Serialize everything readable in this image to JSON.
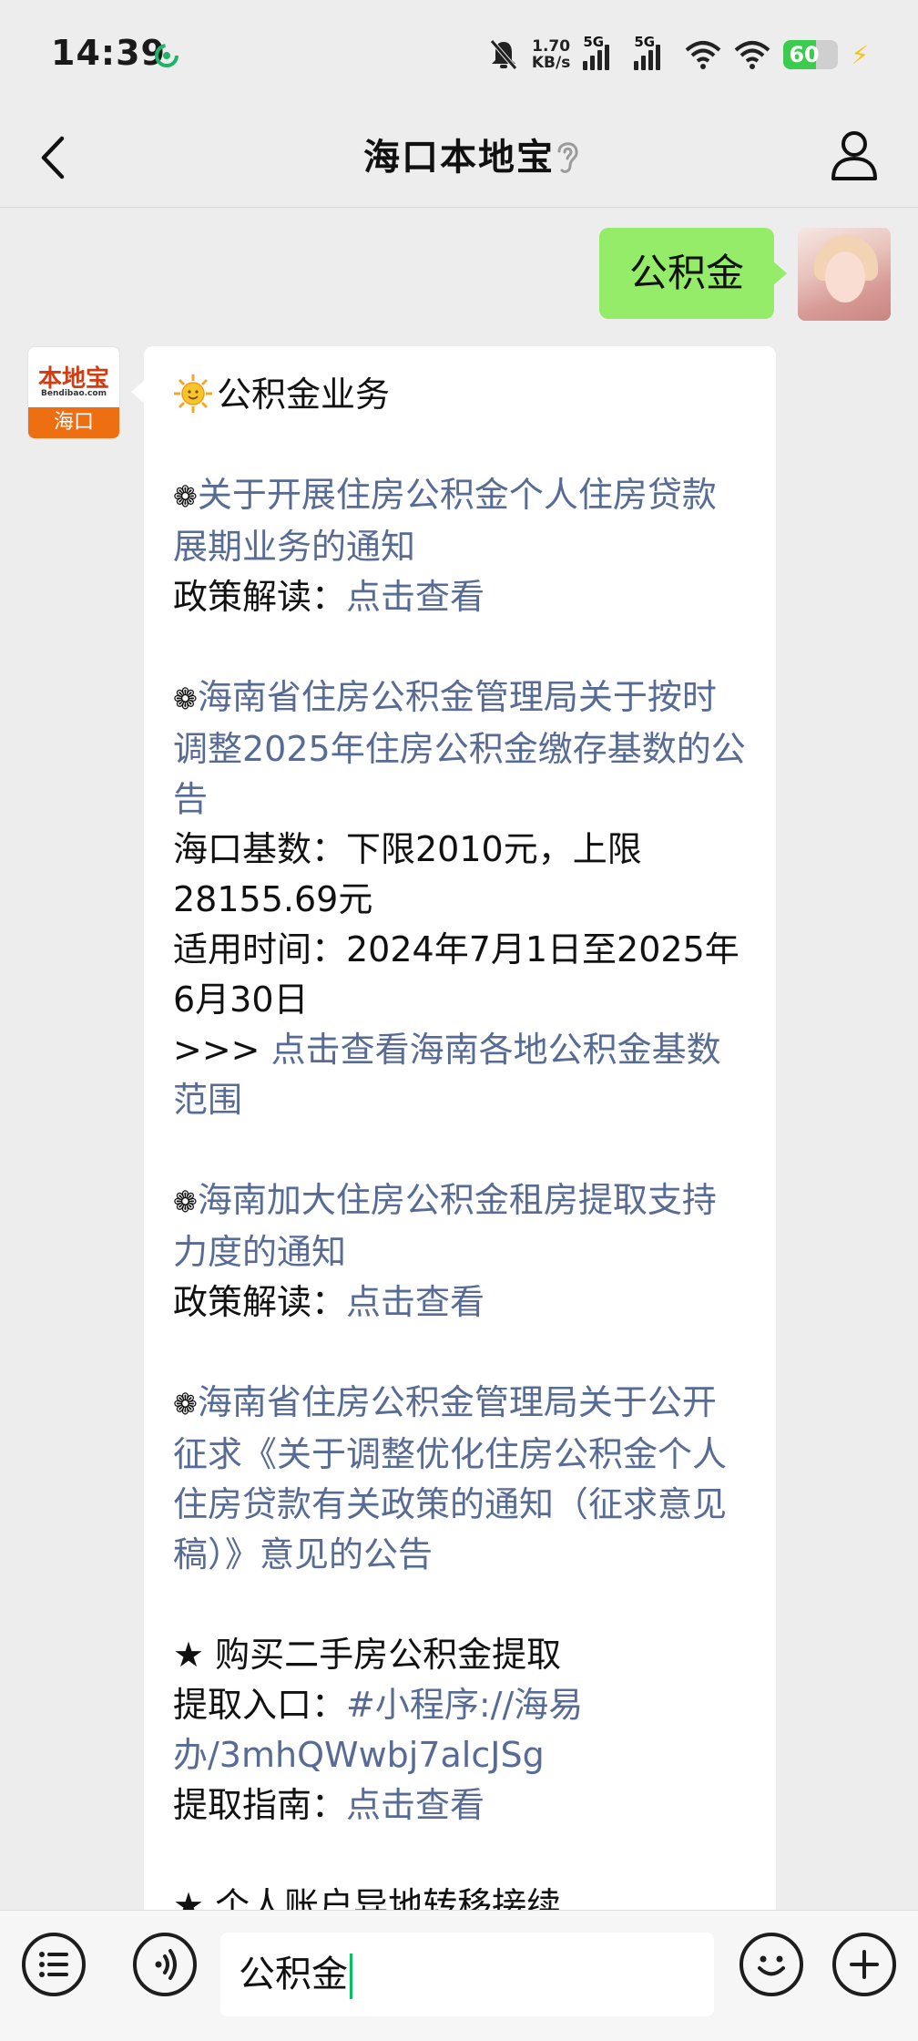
{
  "status": {
    "time": "14:39",
    "net_speed_value": "1.70",
    "net_speed_unit": "KB/s",
    "sim1": "5G",
    "sim2": "5G",
    "battery": "60",
    "battery_level": 0.6
  },
  "nav": {
    "title": "海口本地宝"
  },
  "chat": {
    "my_message": "公积金",
    "bot_avatar": {
      "logo_text": "本地宝",
      "logo_sub": "Bendibao.com",
      "city": "海口"
    },
    "reply": {
      "heading": "公积金业务",
      "items": [
        {
          "bullet": "❁",
          "title": "关于开展住房公积金个人住房贷款展期业务的通知",
          "detail_label": "政策解读：",
          "detail_link": "点击查看"
        },
        {
          "bullet": "❁",
          "title": "海南省住房公积金管理局关于按时调整2025年住房公积金缴存基数的公告",
          "line1": "海口基数：下限2010元，上限28155.69元",
          "line2": "适用时间：2024年7月1日至2025年6月30日",
          "more_prefix": ">>> ",
          "more_link": "点击查看海南各地公积金基数范围"
        },
        {
          "bullet": "❁",
          "title": "海南加大住房公积金租房提取支持力度的通知",
          "detail_label": "政策解读：",
          "detail_link": "点击查看"
        },
        {
          "bullet": "❁",
          "title": "海南省住房公积金管理局关于公开征求《关于调整优化住房公积金个人住房贷款有关政策的通知（征求意见稿）》意见的公告"
        },
        {
          "bullet": "★",
          "heading": "购买二手房公积金提取",
          "entry_label": "提取入口：",
          "entry_link": "#小程序://海易办/3mhQWwbj7alcJSg",
          "guide_label": "提取指南：",
          "guide_link": "点击查看"
        },
        {
          "bullet": "★",
          "heading": "个人账户异地转移接续"
        }
      ]
    }
  },
  "input": {
    "value": "公积金"
  }
}
